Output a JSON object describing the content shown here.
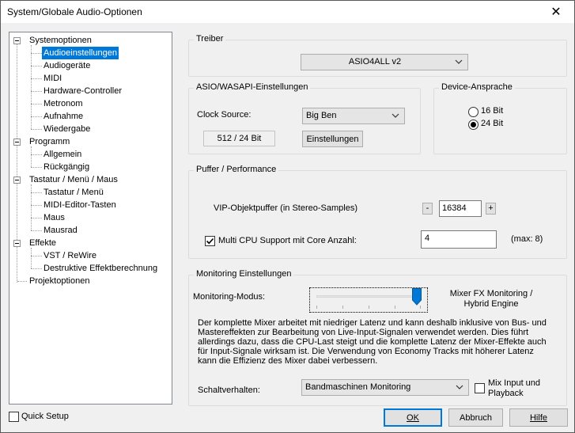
{
  "window": {
    "title": "System/Globale Audio-Optionen",
    "close_glyph": "✕"
  },
  "tree": {
    "items": [
      {
        "label": "Systemoptionen",
        "level": 0,
        "expanded": true
      },
      {
        "label": "Audioeinstellungen",
        "level": 1,
        "selected": true
      },
      {
        "label": "Audiogeräte",
        "level": 1
      },
      {
        "label": "MIDI",
        "level": 1
      },
      {
        "label": "Hardware-Controller",
        "level": 1
      },
      {
        "label": "Metronom",
        "level": 1
      },
      {
        "label": "Aufnahme",
        "level": 1
      },
      {
        "label": "Wiedergabe",
        "level": 1
      },
      {
        "label": "Programm",
        "level": 0,
        "expanded": true
      },
      {
        "label": "Allgemein",
        "level": 1
      },
      {
        "label": "Rückgängig",
        "level": 1
      },
      {
        "label": "Tastatur / Menü / Maus",
        "level": 0,
        "expanded": true
      },
      {
        "label": "Tastatur / Menü",
        "level": 1
      },
      {
        "label": "MIDI-Editor-Tasten",
        "level": 1
      },
      {
        "label": "Maus",
        "level": 1
      },
      {
        "label": "Mausrad",
        "level": 1
      },
      {
        "label": "Effekte",
        "level": 0,
        "expanded": true
      },
      {
        "label": "VST / ReWire",
        "level": 1
      },
      {
        "label": "Destruktive Effektberechnung",
        "level": 1
      },
      {
        "label": "Projektoptionen",
        "level": 0
      }
    ]
  },
  "treiber": {
    "title": "Treiber",
    "driver": "ASIO4ALL v2"
  },
  "asio": {
    "title": "ASIO/WASAPI-Einstellungen",
    "clock_label": "Clock Source:",
    "clock_value": "Big Ben",
    "format": "512 / 24 Bit",
    "settings_button": "Einstellungen"
  },
  "device": {
    "title": "Device-Ansprache",
    "opt16": "16 Bit",
    "opt24": "24 Bit",
    "selected": "24 Bit"
  },
  "puffer": {
    "title": "Puffer / Performance",
    "vip_label": "VIP-Objektpuffer (in Stereo-Samples)",
    "minus": "-",
    "vip_value": "16384",
    "plus": "+",
    "multicpu_label": "Multi CPU Support mit Core Anzahl:",
    "multicpu_checked": true,
    "core_value": "4",
    "max_label": "(max: 8)"
  },
  "monitoring": {
    "title": "Monitoring Einstellungen",
    "mode_label": "Monitoring-Modus:",
    "slider_level": 1.0,
    "mode_value_line1": "Mixer FX Monitoring /",
    "mode_value_line2": "Hybrid Engine",
    "description": "Der komplette Mixer arbeitet mit niedriger Latenz und kann deshalb inklusive von Bus- und Mastereffekten zur Bearbeitung von Live-Input-Signalen verwendet werden. Dies führt allerdings dazu, dass die CPU-Last steigt und die komplette Latenz der Mixer-Effekte auch für Input-Signale wirksam ist. Die Verwendung von Economy Tracks mit höherer Latenz kann die Effizienz des Mixer dabei verbessern.",
    "switch_label": "Schaltverhalten:",
    "switch_value": "Bandmaschinen Monitoring",
    "mix_input_label": "Mix Input und Playback",
    "mix_input_checked": false
  },
  "footer": {
    "quick_setup": "Quick Setup",
    "ok": "OK",
    "cancel": "Abbruch",
    "help": "Hilfe"
  },
  "colors": {
    "selection": "#0078d7",
    "default_button_border": "#0078d7",
    "slider_thumb": "#0078d7"
  }
}
